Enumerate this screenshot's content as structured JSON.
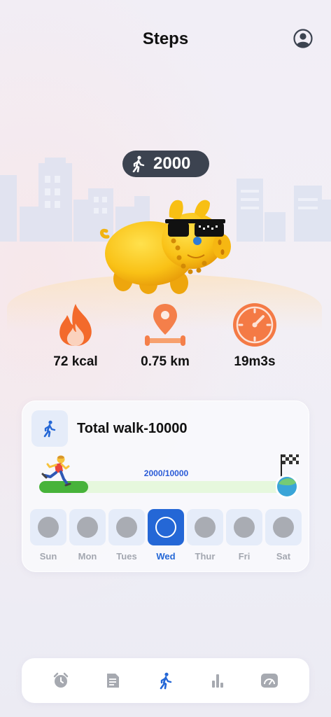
{
  "header": {
    "title": "Steps",
    "profile_icon": "user-circle-icon"
  },
  "steps_badge": {
    "icon": "walk-icon",
    "count": "2000"
  },
  "stats": [
    {
      "id": "calories",
      "icon": "flame-icon",
      "value": "72 kcal"
    },
    {
      "id": "distance",
      "icon": "location-pin-icon",
      "value": "0.75 km"
    },
    {
      "id": "duration",
      "icon": "clock-icon",
      "value": "19m3s"
    }
  ],
  "goal_card": {
    "icon": "walk-icon",
    "title": "Total walk-10000",
    "progress_text": "2000/10000",
    "progress_fraction": 0.2,
    "colors": {
      "fill": "#47b33a",
      "track": "#e6f8dd",
      "accent": "#2467d6"
    }
  },
  "week": {
    "days": [
      {
        "label": "Sun",
        "active": false
      },
      {
        "label": "Mon",
        "active": false
      },
      {
        "label": "Tues",
        "active": false
      },
      {
        "label": "Wed",
        "active": true
      },
      {
        "label": "Thur",
        "active": false
      },
      {
        "label": "Fri",
        "active": false
      },
      {
        "label": "Sat",
        "active": false
      }
    ]
  },
  "tabbar": {
    "tabs": [
      {
        "icon": "alarm-clock-icon",
        "active": false
      },
      {
        "icon": "document-icon",
        "active": false
      },
      {
        "icon": "walk-icon",
        "active": true
      },
      {
        "icon": "bar-chart-icon",
        "active": false
      },
      {
        "icon": "speedometer-icon",
        "active": false
      }
    ]
  }
}
